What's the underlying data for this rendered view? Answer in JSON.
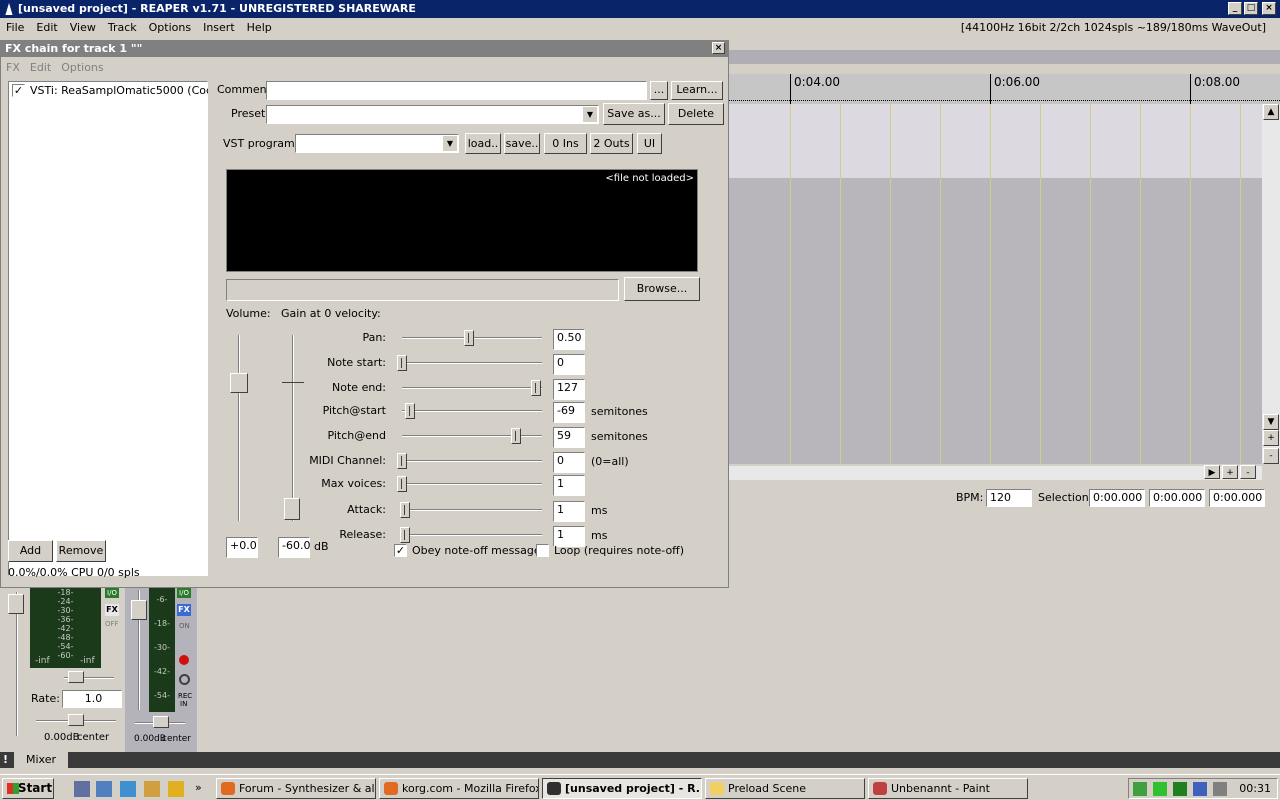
{
  "window": {
    "title": "[unsaved project] - REAPER v1.71 - UNREGISTERED SHAREWARE",
    "status": "[44100Hz 16bit 2/2ch 1024spls ~189/180ms WaveOut]"
  },
  "menu": [
    "File",
    "Edit",
    "View",
    "Track",
    "Options",
    "Insert",
    "Help"
  ],
  "timeline": {
    "labels": [
      "0:04.00",
      "0:06.00",
      "0:08.00"
    ]
  },
  "transport": {
    "bpm_label": "BPM:",
    "bpm": "120",
    "selection_label": "Selection:",
    "sel_start": "0:00.000",
    "sel_end": "0:00.000",
    "sel_len": "0:00.000"
  },
  "fx": {
    "title": "FX chain for track 1 \"\"",
    "menu": [
      "FX",
      "Edit",
      "Options"
    ],
    "plugin": "VSTi: ReaSamplOmatic5000 (Cockos",
    "add": "Add",
    "remove": "Remove",
    "cpu": "0.0%/0.0% CPU 0/0 spls",
    "comment_label": "Comment:",
    "comment": "",
    "dots": "...",
    "learn": "Learn...",
    "preset_label": "Preset:",
    "save_as": "Save as...",
    "delete": "Delete",
    "vst_program_label": "VST program:",
    "load": "load..",
    "save": "save..",
    "ins": "0 Ins",
    "outs": "2 Outs",
    "ui": "UI",
    "file_status": "<file not loaded>",
    "browse": "Browse...",
    "volume_label": "Volume:",
    "gain_label": "Gain at 0 velocity:",
    "volume": "+0.0",
    "gain": "-60.0",
    "db": "dB",
    "params": [
      {
        "label": "Pan:",
        "value": "0.50",
        "unit": "",
        "pos": 0.5
      },
      {
        "label": "Note start:",
        "value": "0",
        "unit": "",
        "pos": 0.0
      },
      {
        "label": "Note end:",
        "value": "127",
        "unit": "",
        "pos": 1.0
      },
      {
        "label": "Pitch@start",
        "value": "-69",
        "unit": "semitones",
        "pos": 0.06
      },
      {
        "label": "Pitch@end",
        "value": "59",
        "unit": "semitones",
        "pos": 0.85
      },
      {
        "label": "MIDI Channel:",
        "value": "0",
        "unit": "(0=all)",
        "pos": 0.0
      },
      {
        "label": "Max voices:",
        "value": "1",
        "unit": "",
        "pos": 0.0
      },
      {
        "label": "Attack:",
        "value": "1",
        "unit": "ms",
        "pos": 0.02
      },
      {
        "label": "Release:",
        "value": "1",
        "unit": "ms",
        "pos": 0.02
      }
    ],
    "obey": "Obey note-off messages",
    "loop": "Loop (requires note-off)"
  },
  "mixer": {
    "rate_label": "Rate:",
    "rate": "1.0",
    "master_db": "0.00dB",
    "master_pan": "center",
    "track_db": "0.00dB",
    "track_pan": "center",
    "master_scale": [
      "-18-",
      "-24-",
      "-30-",
      "-36-",
      "-42-",
      "-48-",
      "-54-",
      "-60-"
    ],
    "track_scale": [
      "-6-",
      "-18-",
      "-30-",
      "-42-",
      "-54-"
    ],
    "inf": "-inf",
    "io": "I/O",
    "fx": "FX",
    "off": "OFF",
    "on": "ON",
    "rec": "REC",
    "in": "IN",
    "tab": "Mixer"
  },
  "taskbar": {
    "start": "Start",
    "tasks": [
      "Forum - Synthesizer & all...",
      "korg.com - Mozilla Firefox",
      "[unsaved project] - R...",
      "Preload Scene",
      "Unbenannt - Paint"
    ],
    "clock": "00:31"
  }
}
